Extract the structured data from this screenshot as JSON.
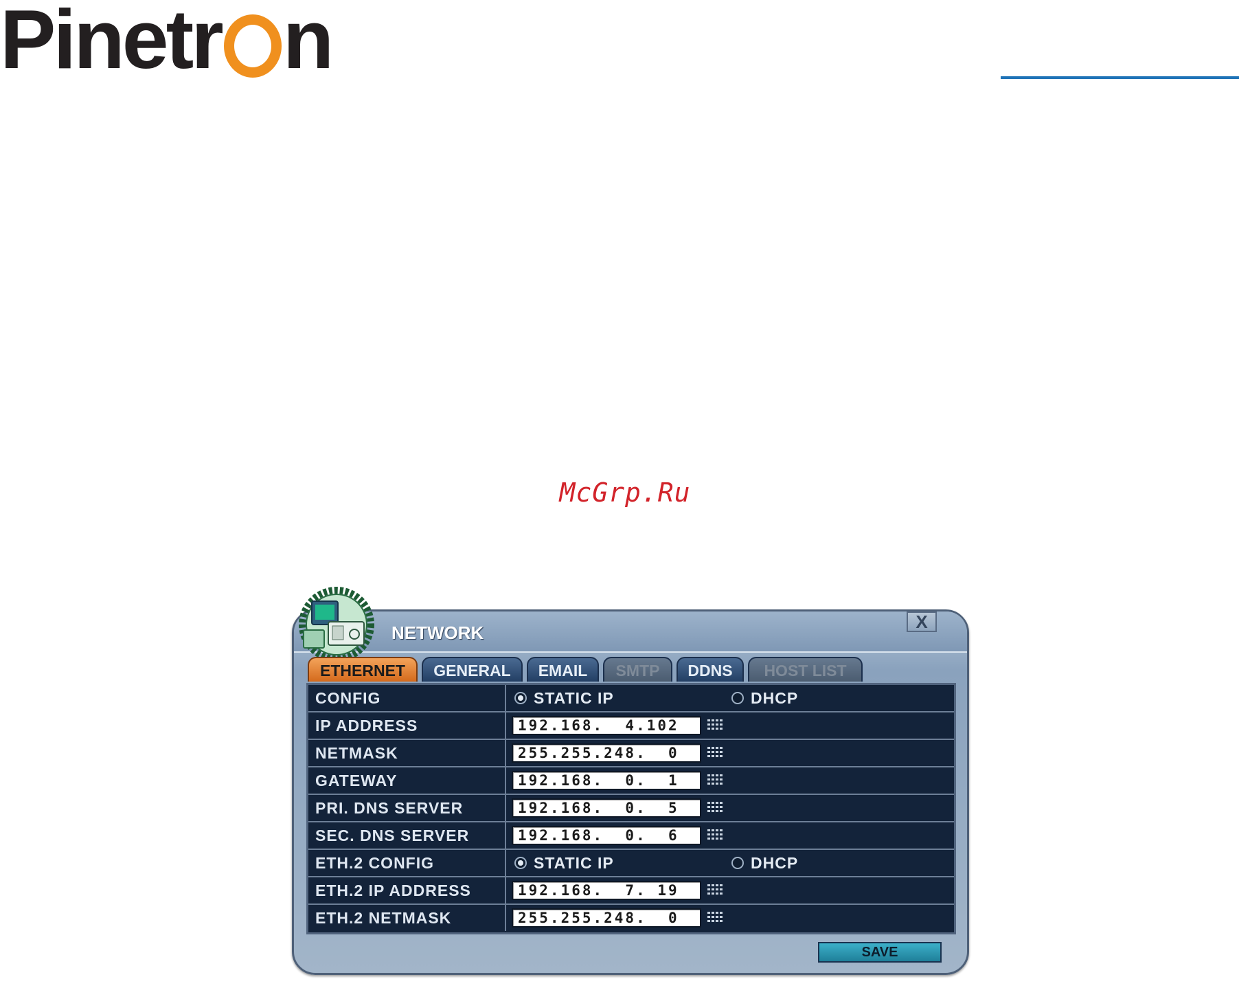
{
  "brand": {
    "logo_left": "Pinetr",
    "logo_right": "n"
  },
  "watermark": "McGrp.Ru",
  "dialog": {
    "title": "NETWORK",
    "close_label": "X",
    "tabs": [
      {
        "label": "ETHERNET",
        "state": "active"
      },
      {
        "label": "GENERAL",
        "state": "normal"
      },
      {
        "label": "EMAIL",
        "state": "normal"
      },
      {
        "label": "SMTP",
        "state": "disabled"
      },
      {
        "label": "DDNS",
        "state": "normal"
      },
      {
        "label": "HOST LIST",
        "state": "disabled"
      }
    ],
    "rows": [
      {
        "label": "CONFIG",
        "type": "radio",
        "options": [
          "STATIC IP",
          "DHCP"
        ],
        "selected": "STATIC IP"
      },
      {
        "label": "IP ADDRESS",
        "type": "ip",
        "value": "192.168.  4.102"
      },
      {
        "label": "NETMASK",
        "type": "ip",
        "value": "255.255.248.  0"
      },
      {
        "label": "GATEWAY",
        "type": "ip",
        "value": "192.168.  0.  1"
      },
      {
        "label": "PRI. DNS SERVER",
        "type": "ip",
        "value": "192.168.  0.  5"
      },
      {
        "label": "SEC. DNS SERVER",
        "type": "ip",
        "value": "192.168.  0.  6"
      },
      {
        "label": "ETH.2 CONFIG",
        "type": "radio",
        "options": [
          "STATIC IP",
          "DHCP"
        ],
        "selected": "STATIC IP"
      },
      {
        "label": "ETH.2 IP ADDRESS",
        "type": "ip",
        "value": "192.168.  7. 19"
      },
      {
        "label": "ETH.2 NETMASK",
        "type": "ip",
        "value": "255.255.248.  0"
      }
    ],
    "save_label": "SAVE"
  },
  "colors": {
    "logo_ring": "#f0901e",
    "rule": "#1f73b7",
    "active_tab": "#e07d2c",
    "panel": "#13233a"
  }
}
